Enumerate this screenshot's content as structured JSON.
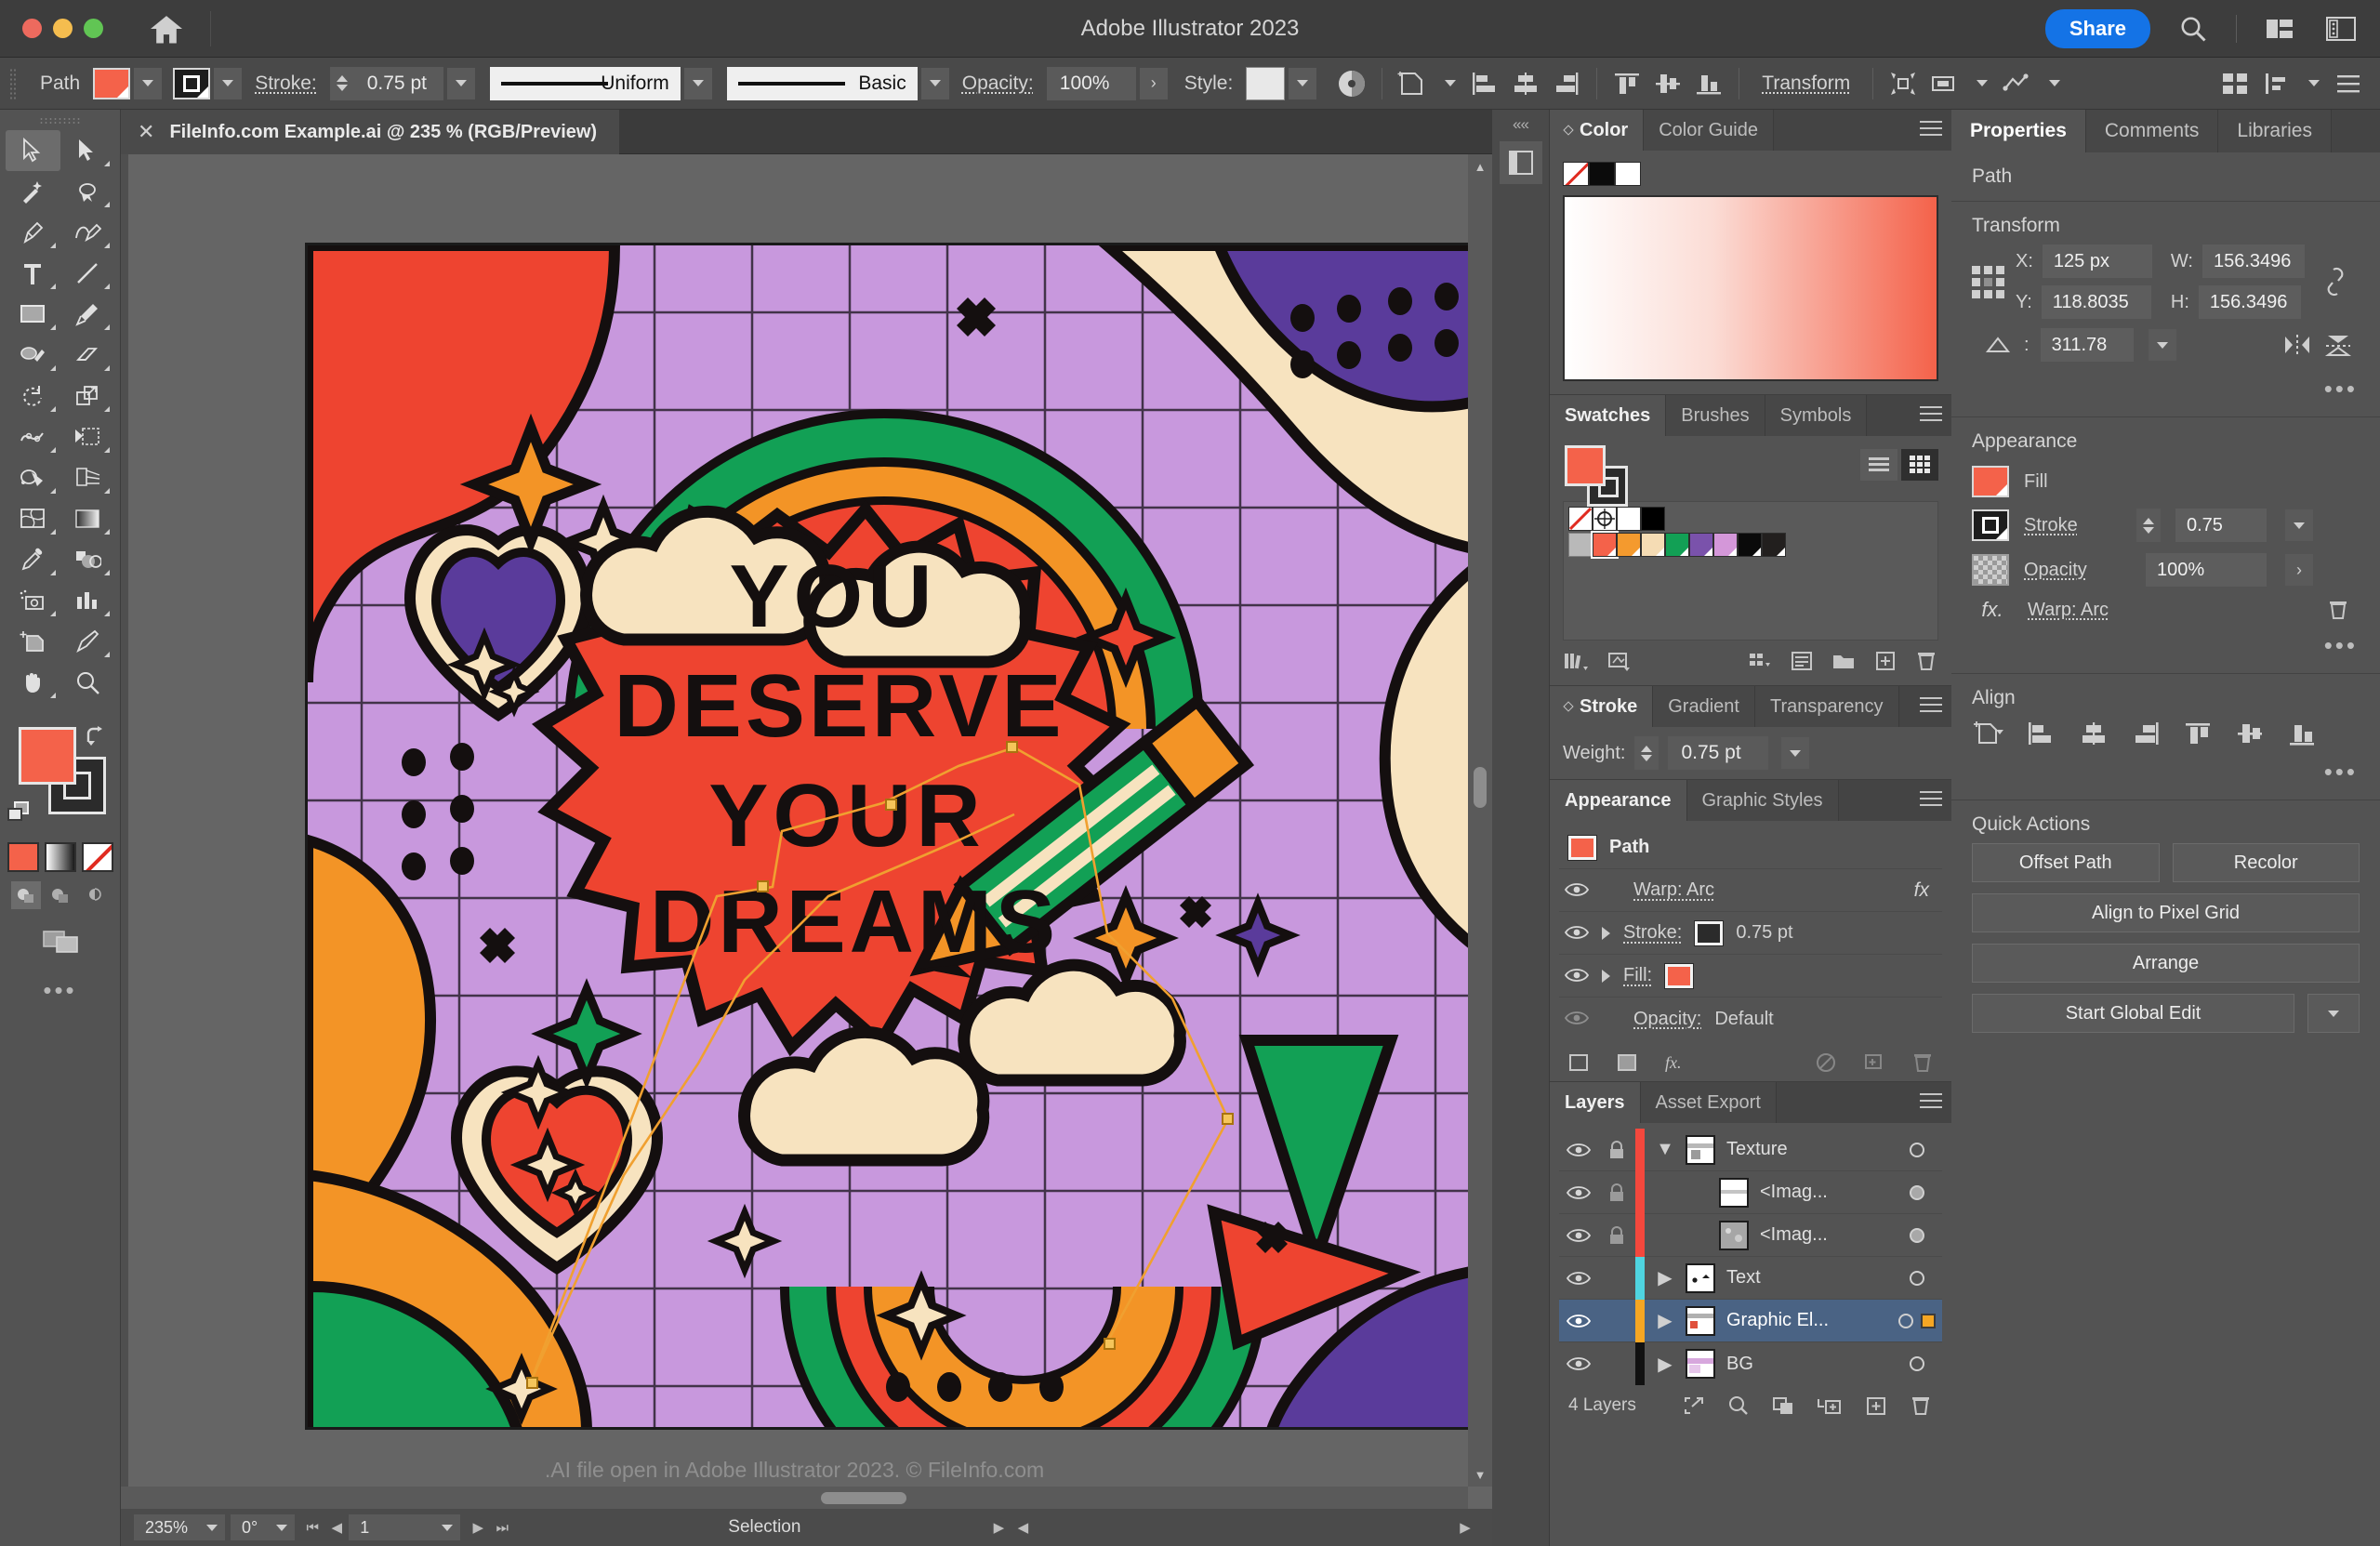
{
  "app": {
    "title": "Adobe Illustrator 2023"
  },
  "titlebar": {
    "share_label": "Share",
    "icons": [
      "home-icon",
      "search-icon",
      "arrange-documents-icon",
      "workspace-switcher-icon"
    ]
  },
  "controlbar": {
    "object_label": "Path",
    "fill_color": "#f4624a",
    "stroke_color": "#2b2b2b",
    "stroke_label": "Stroke:",
    "stroke_weight": "0.75 pt",
    "profile_label": "Uniform",
    "brush_label": "Basic",
    "opacity_label": "Opacity:",
    "opacity_value": "100%",
    "style_label": "Style:",
    "transform_label": "Transform"
  },
  "document": {
    "tab_title": "FileInfo.com Example.ai @ 235 % (RGB/Preview)",
    "caption": ".AI file open in Adobe Illustrator 2023. © FileInfo.com"
  },
  "statusbar": {
    "zoom": "235%",
    "rotation": "0°",
    "artboard_number": "1",
    "tool_status": "Selection"
  },
  "tools": {
    "items": [
      "selection-tool",
      "direct-selection-tool",
      "magic-wand-tool",
      "lasso-tool",
      "pen-tool",
      "curvature-tool",
      "type-tool",
      "line-segment-tool",
      "rectangle-tool",
      "paintbrush-tool",
      "shaper-tool",
      "eraser-tool",
      "rotate-tool",
      "scale-tool",
      "width-tool",
      "free-transform-tool",
      "shape-builder-tool",
      "perspective-grid-tool",
      "mesh-tool",
      "gradient-tool",
      "eyedropper-tool",
      "blend-tool",
      "symbol-sprayer-tool",
      "column-graph-tool",
      "artboard-tool",
      "slice-tool",
      "hand-tool",
      "zoom-tool"
    ],
    "fill_color": "#f4624a",
    "stroke_color": "#2b2b2b",
    "modes": [
      "color-mode-icon",
      "gradient-mode-icon",
      "none-mode-icon"
    ],
    "draw_modes": [
      "draw-normal-icon",
      "draw-behind-icon",
      "draw-inside-icon"
    ],
    "screen_mode": "screen-mode-icon",
    "more_tools": "edit-toolbar-icon"
  },
  "color_panel": {
    "tabs": [
      {
        "label": "Color",
        "active": true
      },
      {
        "label": "Color Guide",
        "active": false
      }
    ],
    "swatches": [
      "none-swatch",
      "black-swatch",
      "white-swatch"
    ],
    "spectrum": {
      "from": "#ffffff",
      "to": "#f4624a"
    }
  },
  "swatches_panel": {
    "tabs": [
      {
        "label": "Swatches",
        "active": true
      },
      {
        "label": "Brushes",
        "active": false
      },
      {
        "label": "Symbols",
        "active": false
      }
    ],
    "fill_color": "#f4624a",
    "stroke_color": "#2b2b2b",
    "view_list_icon": "list-view-icon",
    "view_grid_icon": "grid-view-icon",
    "row1": [
      "none",
      "registration",
      "#ffffff",
      "#000000"
    ],
    "row2_colors": [
      "#f4624a",
      "#f49a2e",
      "#f5dcb4",
      "#12a055",
      "#7a52ab",
      "#d497d9",
      "#0a0a0a",
      "#221f1e"
    ],
    "footer_icons": [
      "swatch-libraries-icon",
      "color-theme-icon",
      "show-kinds-icon",
      "swatch-options-icon",
      "new-color-group-icon",
      "new-swatch-icon",
      "delete-swatch-icon"
    ]
  },
  "stroke_panel": {
    "tabs": [
      {
        "label": "Stroke",
        "active": true
      },
      {
        "label": "Gradient",
        "active": false
      },
      {
        "label": "Transparency",
        "active": false
      }
    ],
    "weight_label": "Weight:",
    "weight_value": "0.75 pt"
  },
  "appearance_panel": {
    "tabs": [
      {
        "label": "Appearance",
        "active": true
      },
      {
        "label": "Graphic Styles",
        "active": false
      }
    ],
    "object_name": "Path",
    "rows": [
      {
        "name": "Warp: Arc",
        "type": "effect",
        "fx": "fx"
      },
      {
        "name": "Stroke:",
        "type": "stroke",
        "value": "0.75 pt",
        "color": "#2b2b2b"
      },
      {
        "name": "Fill:",
        "type": "fill",
        "value": "",
        "color": "#f4624a"
      },
      {
        "name": "Opacity:",
        "type": "opacity",
        "value": "Default"
      }
    ],
    "footer_icons": [
      "add-new-stroke-icon",
      "add-new-fill-icon",
      "add-new-effect-icon",
      "clear-appearance-icon",
      "duplicate-item-icon",
      "delete-item-icon"
    ]
  },
  "layers_panel": {
    "tabs": [
      {
        "label": "Layers",
        "active": true
      },
      {
        "label": "Asset Export",
        "active": false
      }
    ],
    "rows": [
      {
        "name": "Texture",
        "color": "#f4483d",
        "locked": true,
        "expanded": true,
        "indent": 0,
        "selected": false,
        "target_filled": false
      },
      {
        "name": "<Imag...",
        "color": "#f4483d",
        "locked": true,
        "expanded": false,
        "indent": 1,
        "selected": false,
        "target_filled": true
      },
      {
        "name": "<Imag...",
        "color": "#f4483d",
        "locked": true,
        "expanded": false,
        "indent": 1,
        "selected": false,
        "target_filled": true
      },
      {
        "name": "Text",
        "color": "#4fd4e0",
        "locked": false,
        "expanded": false,
        "indent": 0,
        "selected": false,
        "target_filled": false
      },
      {
        "name": "Graphic El...",
        "color": "#f5a623",
        "locked": false,
        "expanded": false,
        "indent": 0,
        "selected": true,
        "target_filled": false
      },
      {
        "name": "BG",
        "color": "#111111",
        "locked": false,
        "expanded": false,
        "indent": 0,
        "selected": false,
        "target_filled": false
      }
    ],
    "count_label": "4 Layers",
    "footer_icons": [
      "release-to-layers-icon",
      "locate-object-icon",
      "make-clipping-mask-icon",
      "create-new-sublayer-icon",
      "create-new-layer-icon",
      "delete-selection-icon"
    ]
  },
  "properties_panel": {
    "tabs": [
      {
        "label": "Properties",
        "active": true
      },
      {
        "label": "Comments",
        "active": false
      },
      {
        "label": "Libraries",
        "active": false
      }
    ],
    "object_type": "Path",
    "transform": {
      "title": "Transform",
      "x_label": "X:",
      "x_value": "125 px",
      "y_label": "Y:",
      "y_value": "118.8035",
      "w_label": "W:",
      "w_value": "156.3496",
      "h_label": "H:",
      "h_value": "156.3496",
      "angle_value": "311.78",
      "link_icon": "unlink-proportions-icon",
      "flip_h_icon": "flip-horizontal-icon",
      "flip_v_icon": "flip-vertical-icon",
      "more_icon": "more-options-icon"
    },
    "appearance": {
      "title": "Appearance",
      "fill_label": "Fill",
      "fill_color": "#f4624a",
      "stroke_label": "Stroke",
      "stroke_value": "0.75",
      "opacity_label": "Opacity",
      "opacity_value": "100%",
      "effect_label": "Warp: Arc",
      "delete_icon": "delete-effect-icon"
    },
    "align": {
      "title": "Align",
      "icons": [
        "align-to-selection-icon",
        "align-left-icon",
        "align-horizontal-center-icon",
        "align-right-icon",
        "align-top-icon",
        "align-vertical-center-icon",
        "align-bottom-icon"
      ]
    },
    "quick_actions": {
      "title": "Quick Actions",
      "offset_path": "Offset Path",
      "recolor": "Recolor",
      "align_pixel_grid": "Align to Pixel Grid",
      "arrange": "Arrange",
      "start_global_edit": "Start Global Edit"
    }
  },
  "artwork": {
    "headline_lines": [
      "YOU",
      "DESERVE",
      "YOUR",
      "DREAMS"
    ],
    "palette": {
      "background_grid": "#c898dd",
      "red": "#ee4430",
      "orange": "#f39426",
      "green": "#12a055",
      "purple": "#5a3b9b",
      "cream": "#f7e3bf",
      "black": "#140f0f"
    }
  }
}
